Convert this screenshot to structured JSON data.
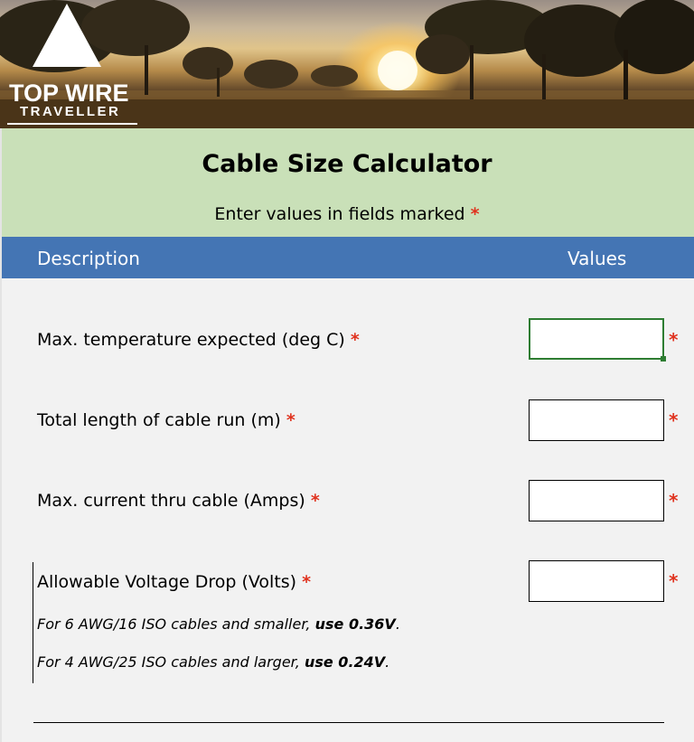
{
  "logo": {
    "title": "TOP WIRE",
    "subtitle": "TRAVELLER"
  },
  "header": {
    "title": "Cable Size Calculator",
    "instruction": "Enter values in fields marked",
    "required_marker": "*"
  },
  "columns": {
    "description": "Description",
    "values": "Values"
  },
  "fields": [
    {
      "label": "Max. temperature expected (deg C)",
      "value": "",
      "active": true
    },
    {
      "label": "Total length of cable run (m)",
      "value": ""
    },
    {
      "label": "Max. current thru cable (Amps)",
      "value": ""
    },
    {
      "label": "Allowable Voltage Drop (Volts)",
      "value": ""
    }
  ],
  "notes": [
    {
      "prefix": "For 6 AWG/16 ISO cables and smaller,",
      "emph": "use 0.36V",
      "suffix": "."
    },
    {
      "prefix": "For 4 AWG/25 ISO cables and larger,",
      "emph": "use 0.24V",
      "suffix": "."
    }
  ],
  "colors": {
    "header_bg": "#c9e0b8",
    "column_bar": "#4475b4",
    "required_star": "#e0321e",
    "active_border": "#2e7d32"
  }
}
